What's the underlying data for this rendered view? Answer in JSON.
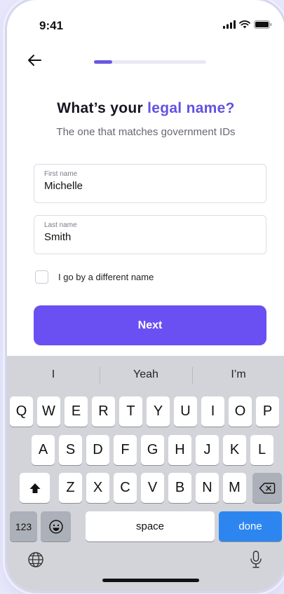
{
  "status_bar": {
    "time": "9:41"
  },
  "progress": {
    "fraction": 0.16
  },
  "heading": {
    "prefix": "What’s your ",
    "accent": "legal name?"
  },
  "subheading": "The one that matches government IDs",
  "form": {
    "first_name": {
      "label": "First name",
      "value": "Michelle"
    },
    "last_name": {
      "label": "Last name",
      "value": "Smith"
    },
    "different_name": {
      "label": "I go by a different name",
      "checked": false
    },
    "next_label": "Next"
  },
  "keyboard": {
    "suggestions": [
      "I",
      "Yeah",
      "I’m"
    ],
    "row1": [
      "Q",
      "W",
      "E",
      "R",
      "T",
      "Y",
      "U",
      "I",
      "O",
      "P"
    ],
    "row2": [
      "A",
      "S",
      "D",
      "F",
      "G",
      "H",
      "J",
      "K",
      "L"
    ],
    "row3": [
      "Z",
      "X",
      "C",
      "V",
      "B",
      "N",
      "M"
    ],
    "numbers_label": "123",
    "space_label": "space",
    "done_label": "done"
  },
  "colors": {
    "accent": "#6152e0",
    "button": "#6a4ff3",
    "done": "#2d86f0"
  },
  "icons": [
    "signal-icon",
    "wifi-icon",
    "battery-icon",
    "back-arrow-icon",
    "shift-icon",
    "backspace-icon",
    "emoji-icon",
    "globe-icon",
    "microphone-icon"
  ]
}
